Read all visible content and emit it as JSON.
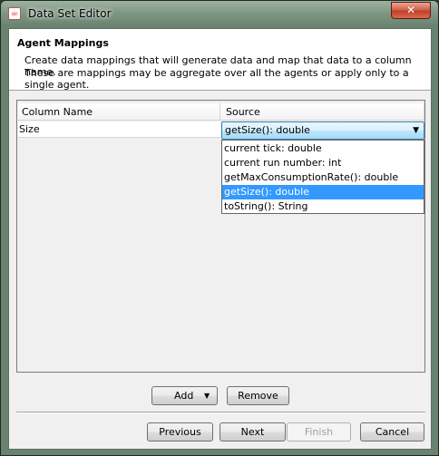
{
  "window": {
    "title": "Data Set Editor",
    "close_glyph": "✕",
    "app_icon": "java-icon"
  },
  "header": {
    "title": "Agent Mappings",
    "desc_line1": "Create data mappings that will generate data and map that data to a column name.",
    "desc_line2": "These are mappings may be aggregate over all the agents or apply only to a single agent."
  },
  "table": {
    "columns": [
      "Column Name",
      "Source"
    ],
    "rows": [
      {
        "name": "Size",
        "source": "getSize(): double"
      }
    ]
  },
  "dropdown": {
    "options": [
      "current tick: double",
      "current run number: int",
      "getMaxConsumptionRate(): double",
      "getSize(): double",
      "toString(): String"
    ],
    "selected": "getSize(): double"
  },
  "buttons": {
    "add": "Add",
    "add_arrow": "▼",
    "remove": "Remove",
    "previous": "Previous",
    "next": "Next",
    "finish": "Finish",
    "cancel": "Cancel"
  }
}
